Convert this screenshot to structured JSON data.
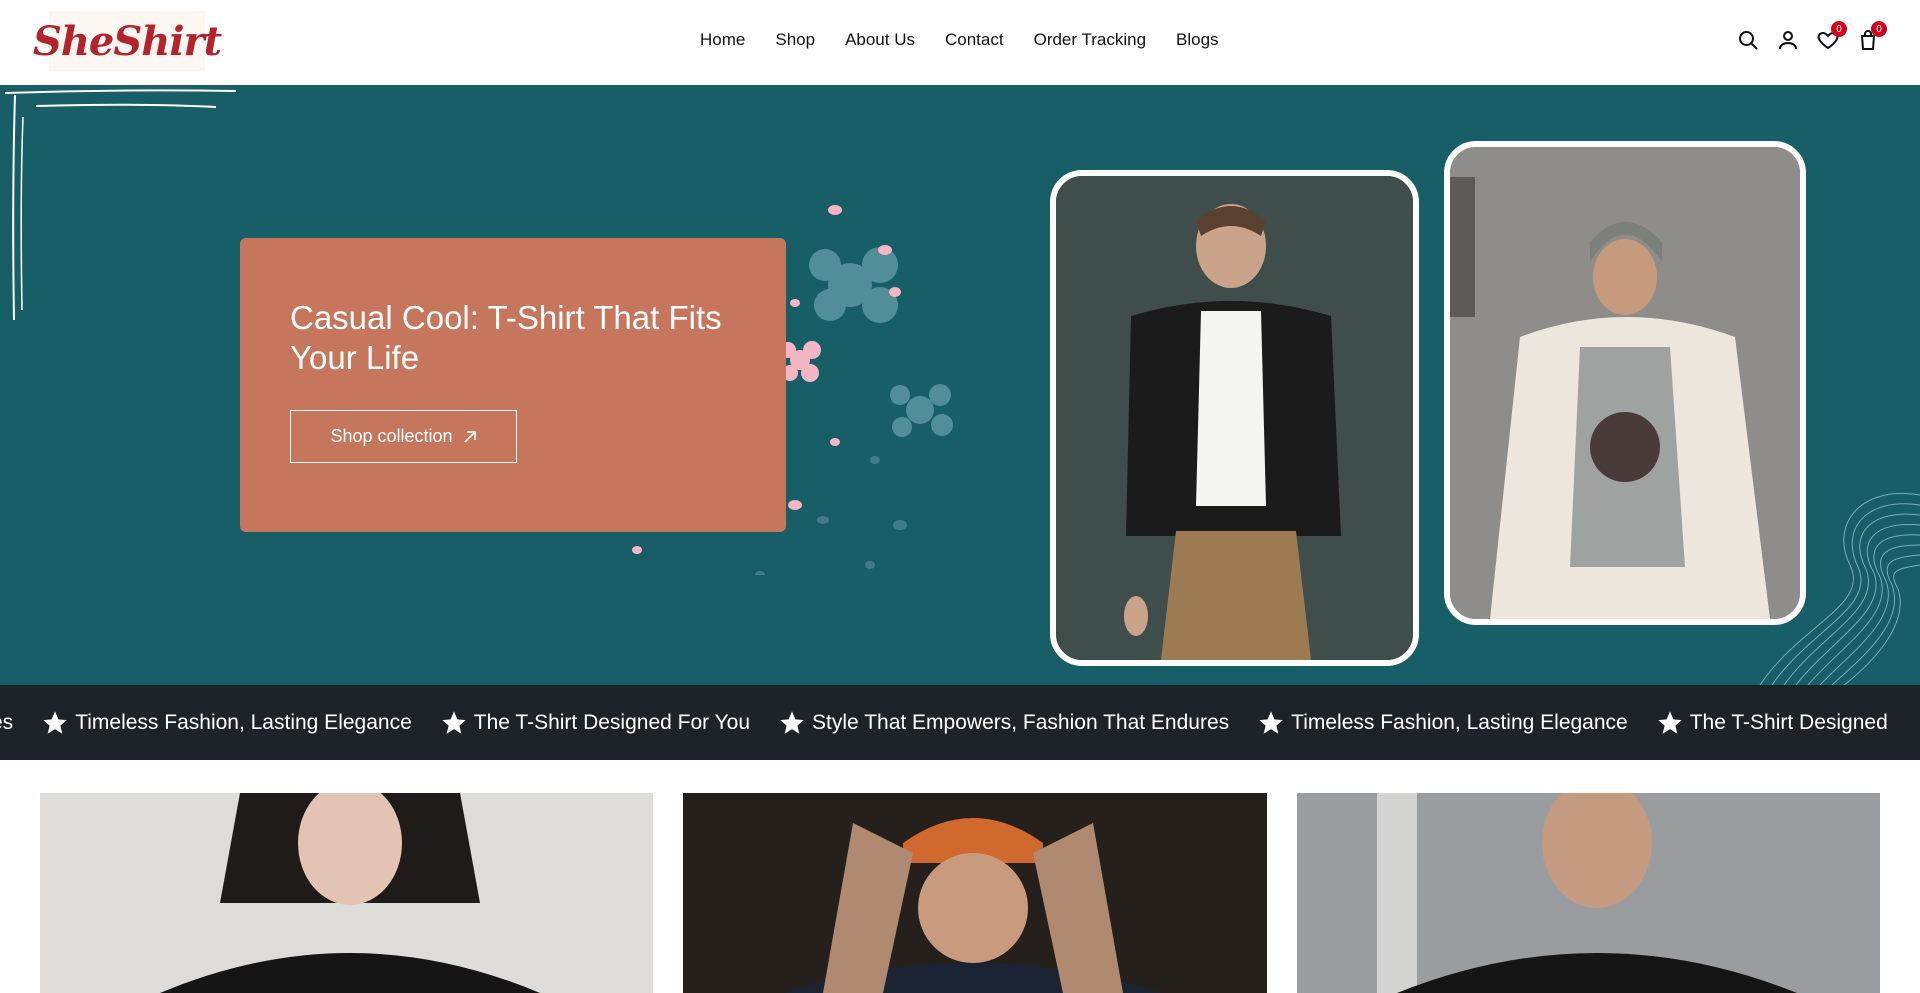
{
  "header": {
    "logo_text": "SheShirt",
    "nav": [
      "Home",
      "Shop",
      "About Us",
      "Contact",
      "Order Tracking",
      "Blogs"
    ],
    "icons": [
      "search-icon",
      "user-icon",
      "heart-icon",
      "cart-icon"
    ],
    "wishlist_count": "0",
    "cart_count": "0"
  },
  "hero": {
    "title": "Casual Cool: T-Shirt That Fits Your Life",
    "cta_label": "Shop collection",
    "background_color": "#175e66",
    "card_color": "#c5765c"
  },
  "marquee": {
    "items": [
      "res",
      "Timeless Fashion, Lasting Elegance",
      "The T-Shirt Designed For You",
      "Style That Empowers, Fashion That Endures",
      "Timeless Fashion, Lasting Elegance",
      "The T-Shirt Designed"
    ]
  },
  "colors": {
    "accent": "#c5765c",
    "badge": "#d0021b",
    "strip": "#1e2329"
  }
}
